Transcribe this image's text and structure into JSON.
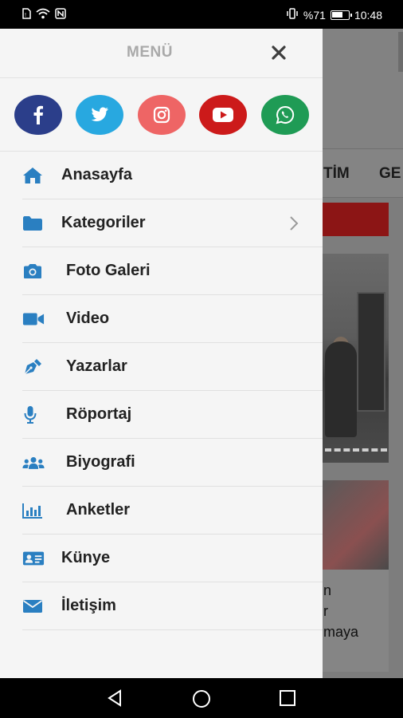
{
  "status_bar": {
    "battery_percent": "%71",
    "time": "10:48",
    "battery_level": 0.71,
    "left_icons": [
      "sim-icon",
      "wifi-icon",
      "nfc-icon"
    ],
    "right_icons": [
      "vibrate-icon",
      "battery-icon"
    ]
  },
  "background": {
    "nav_items": [
      "TİM",
      "GE"
    ],
    "card_lines": [
      "n",
      "r",
      "maya"
    ]
  },
  "drawer": {
    "title": "MENÜ",
    "close_icon": "close-icon",
    "social": [
      {
        "name": "facebook",
        "icon": "facebook-icon",
        "color": "#2b3e8a"
      },
      {
        "name": "twitter",
        "icon": "twitter-icon",
        "color": "#28a8e0"
      },
      {
        "name": "instagram",
        "icon": "instagram-icon",
        "color": "#ee6565"
      },
      {
        "name": "youtube",
        "icon": "youtube-icon",
        "color": "#cc1a1a"
      },
      {
        "name": "whatsapp",
        "icon": "whatsapp-icon",
        "color": "#1f9b55"
      }
    ],
    "items": [
      {
        "label": "Anasayfa",
        "icon": "home-icon"
      },
      {
        "label": "Kategoriler",
        "icon": "folder-icon",
        "has_submenu": true
      },
      {
        "label": "Foto Galeri",
        "icon": "camera-icon"
      },
      {
        "label": "Video",
        "icon": "video-icon"
      },
      {
        "label": "Yazarlar",
        "icon": "pen-icon"
      },
      {
        "label": "Röportaj",
        "icon": "microphone-icon"
      },
      {
        "label": "Biyografi",
        "icon": "users-icon"
      },
      {
        "label": "Anketler",
        "icon": "chart-icon"
      },
      {
        "label": "Künye",
        "icon": "id-card-icon"
      },
      {
        "label": "İletişim",
        "icon": "envelope-icon"
      }
    ]
  },
  "colors": {
    "accent": "#2a7fc1",
    "drawer_bg": "#f5f5f5",
    "dim_overlay": "#7d7d7d"
  },
  "nav_bar": {
    "buttons": [
      "back-icon",
      "home-circle-icon",
      "recents-icon"
    ]
  }
}
